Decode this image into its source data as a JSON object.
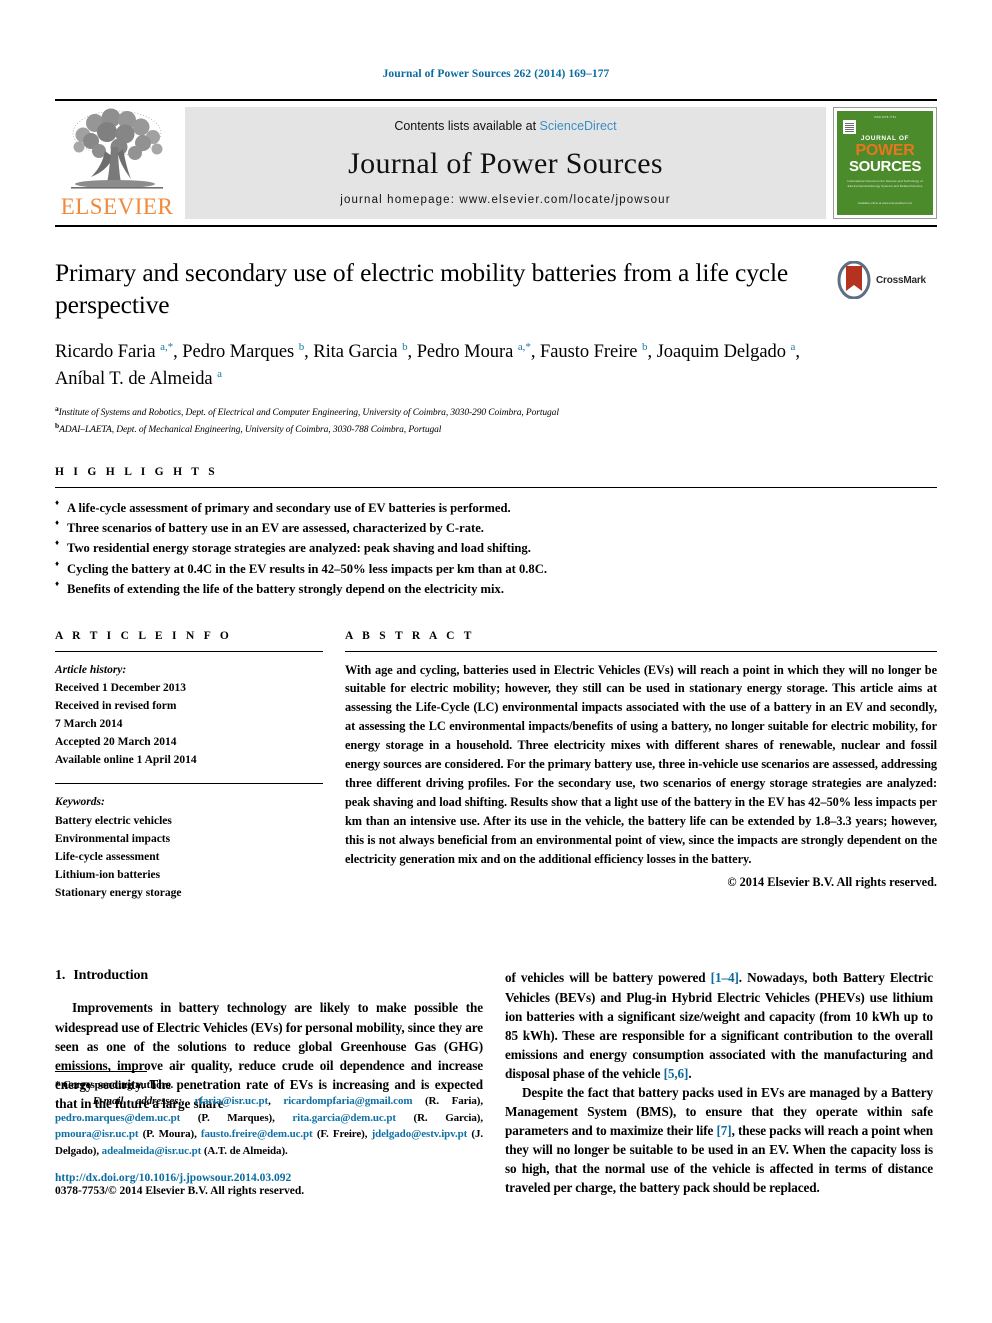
{
  "running_head": "Journal of Power Sources 262 (2014) 169–177",
  "masthead": {
    "publisher_name": "ELSEVIER",
    "contents_prefix": "Contents lists available at ",
    "contents_link": "ScienceDirect",
    "journal_title": "Journal of Power Sources",
    "homepage": "journal homepage: www.elsevier.com/locate/jpowsour",
    "cover": {
      "top_line": "ISSN 0378-7753",
      "journal_of": "JOURNAL OF",
      "power": "POWER",
      "sources": "SOURCES",
      "subtitle": "International Journal on the Science and Technology of Electrochemical Energy Systems and Related Devices",
      "footer": "Available online at www.sciencedirect.com"
    }
  },
  "article": {
    "title": "Primary and secondary use of electric mobility batteries from a life cycle perspective",
    "crossmark_label": "CrossMark",
    "authors_html": "Ricardo Faria <sup>a,*</sup>, Pedro Marques <sup>b</sup>, Rita Garcia <sup>b</sup>, Pedro Moura <sup>a,*</sup>, Fausto Freire <sup>b</sup>, Joaquim Delgado <sup>a</sup>, Aníbal T. de Almeida <sup>a</sup>",
    "affiliations": [
      {
        "marker": "a",
        "text": "Institute of Systems and Robotics, Dept. of Electrical and Computer Engineering, University of Coimbra, 3030-290 Coimbra, Portugal"
      },
      {
        "marker": "b",
        "text": "ADAI–LAETA, Dept. of Mechanical Engineering, University of Coimbra, 3030-788 Coimbra, Portugal"
      }
    ]
  },
  "highlights": {
    "heading": "H I G H L I G H T S",
    "items": [
      "A life-cycle assessment of primary and secondary use of EV batteries is performed.",
      "Three scenarios of battery use in an EV are assessed, characterized by C-rate.",
      "Two residential energy storage strategies are analyzed: peak shaving and load shifting.",
      "Cycling the battery at 0.4C in the EV results in 42–50% less impacts per km than at 0.8C.",
      "Benefits of extending the life of the battery strongly depend on the electricity mix."
    ]
  },
  "article_info": {
    "heading": "A R T I C L E   I N F O",
    "history_label": "Article history:",
    "history": [
      "Received 1 December 2013",
      "Received in revised form",
      "7 March 2014",
      "Accepted 20 March 2014",
      "Available online 1 April 2014"
    ],
    "keywords_label": "Keywords:",
    "keywords": [
      "Battery electric vehicles",
      "Environmental impacts",
      "Life-cycle assessment",
      "Lithium-ion batteries",
      "Stationary energy storage"
    ]
  },
  "abstract": {
    "heading": "A B S T R A C T",
    "text": "With age and cycling, batteries used in Electric Vehicles (EVs) will reach a point in which they will no longer be suitable for electric mobility; however, they still can be used in stationary energy storage. This article aims at assessing the Life-Cycle (LC) environmental impacts associated with the use of a battery in an EV and secondly, at assessing the LC environmental impacts/benefits of using a battery, no longer suitable for electric mobility, for energy storage in a household. Three electricity mixes with different shares of renewable, nuclear and fossil energy sources are considered. For the primary battery use, three in-vehicle use scenarios are assessed, addressing three different driving profiles. For the secondary use, two scenarios of energy storage strategies are analyzed: peak shaving and load shifting. Results show that a light use of the battery in the EV has 42–50% less impacts per km than an intensive use. After its use in the vehicle, the battery life can be extended by 1.8–3.3 years; however, this is not always beneficial from an environmental point of view, since the impacts are strongly dependent on the electricity generation mix and on the additional efficiency losses in the battery.",
    "copyright": "© 2014 Elsevier B.V. All rights reserved."
  },
  "introduction": {
    "number": "1.",
    "heading": "Introduction",
    "left_paragraph": "Improvements in battery technology are likely to make possible the widespread use of Electric Vehicles (EVs) for personal mobility, since they are seen as one of the solutions to reduce global Greenhouse Gas (GHG) emissions, improve air quality, reduce crude oil dependence and increase energy security. The penetration rate of EVs is increasing and is expected that in the future a large share",
    "right_paragraph_1_pre": "of vehicles will be battery powered ",
    "right_paragraph_1_ref1": "[1–4]",
    "right_paragraph_1_mid": ". Nowadays, both Battery Electric Vehicles (BEVs) and Plug-in Hybrid Electric Vehicles (PHEVs) use lithium ion batteries with a significant size/weight and capacity (from 10 kWh up to 85 kWh). These are responsible for a significant contribution to the overall emissions and energy consumption associated with the manufacturing and disposal phase of the vehicle ",
    "right_paragraph_1_ref2": "[5,6]",
    "right_paragraph_1_post": ".",
    "right_paragraph_2_pre": "Despite the fact that battery packs used in EVs are managed by a Battery Management System (BMS), to ensure that they operate within safe parameters and to maximize their life ",
    "right_paragraph_2_ref": "[7]",
    "right_paragraph_2_post": ", these packs will reach a point when they will no longer be suitable to be used in an EV. When the capacity loss is so high, that the normal use of the vehicle is affected in terms of distance traveled per charge, the battery pack should be replaced."
  },
  "footnotes": {
    "corresponding": "* Corresponding authors.",
    "email_label": "E-mail addresses:",
    "emails": [
      {
        "mail": "rfaria@isr.uc.pt",
        "sep": ", "
      },
      {
        "mail": "ricardompfaria@gmail.com",
        "sep": " (R. Faria), "
      },
      {
        "mail": "pedro.marques@dem.uc.pt",
        "sep": " (P. Marques), "
      },
      {
        "mail": "rita.garcia@dem.uc.pt",
        "sep": " (R. Garcia), "
      },
      {
        "mail": "pmoura@isr.uc.pt",
        "sep": " (P. Moura), "
      },
      {
        "mail": "fausto.freire@dem.uc.pt",
        "sep": " (F. Freire), "
      },
      {
        "mail": "jdelgado@estv.ipv.pt",
        "sep": " (J. Delgado), "
      },
      {
        "mail": "adealmeida@isr.uc.pt",
        "sep": " (A.T. de Almeida)."
      }
    ],
    "doi": "http://dx.doi.org/10.1016/j.jpowsour.2014.03.092",
    "issn": "0378-7753/© 2014 Elsevier B.V. All rights reserved."
  },
  "colors": {
    "link_blue": "#0b6ba0",
    "sciencedirect_blue": "#3a8fc4",
    "elsevier_orange": "#f0893b",
    "cover_green": "#4c8b2b"
  }
}
